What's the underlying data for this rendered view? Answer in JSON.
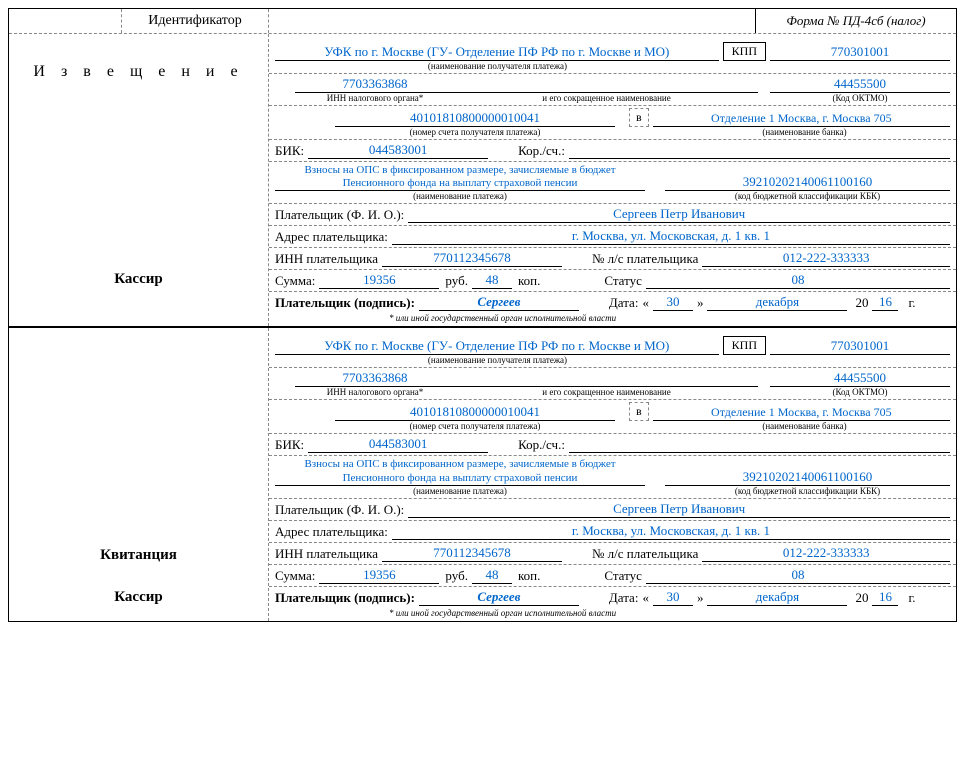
{
  "header": {
    "identifier_label": "Идентификатор",
    "form_title": "Форма № ПД-4сб (налог)"
  },
  "labels": {
    "notice": "И з в е щ е н и е",
    "receipt": "Квитанция",
    "cashier": "Кассир",
    "kpp": "КПП",
    "recipient_name_sub": "(наименование получателя платежа)",
    "inn_tax_sub": "ИНН налогового органа*",
    "and_short_name": "и его сокращенное наименование",
    "oktmo_sub": "(Код ОКТМО)",
    "account_sub": "(номер счета получателя платежа)",
    "v": "в",
    "bank_sub": "(наименование банка)",
    "bik": "БИК:",
    "kor": "Кор./сч.:",
    "payment_name_sub": "(наименование платежа)",
    "kbk_sub": "(код бюджетной классификации КБК)",
    "payer": "Плательщик (Ф. И. О.):",
    "payer_addr": "Адрес плательщика:",
    "payer_inn": "ИНН плательщика",
    "payer_acc": "№ л/с плательщика",
    "sum": "Сумма:",
    "rub": "руб.",
    "kop": "коп.",
    "status": "Статус",
    "signature": "Плательщик (подпись):",
    "date": "Дата:",
    "quote_open": "«",
    "quote_close": "»",
    "year_prefix": "20",
    "year_suffix": "г.",
    "footnote": "* или иной государственный орган исполнительной власти"
  },
  "data": {
    "recipient": "УФК по г. Москве (ГУ- Отделение ПФ РФ по г. Москве и МО)",
    "kpp": "770301001",
    "inn_tax": "7703363868",
    "oktmo": "44455500",
    "account": "40101810800000010041",
    "bank": "Отделение 1 Москва, г. Москва 705",
    "bik": "044583001",
    "kor": "",
    "payment_desc": "Взносы на ОПС в фиксированном размере, зачисляемые в бюджет Пенсионного фонда на выплату страховой пенсии",
    "kbk": "39210202140061100160",
    "payer_name": "Сергеев Петр Иванович",
    "payer_addr": "г. Москва, ул. Московская, д. 1 кв. 1",
    "payer_inn": "770112345678",
    "payer_acc": "012-222-333333",
    "sum_rub": "19356",
    "sum_kop": "48",
    "status": "08",
    "signature": "Сергеев",
    "date_day": "30",
    "date_month": "декабря",
    "date_year": "16"
  }
}
